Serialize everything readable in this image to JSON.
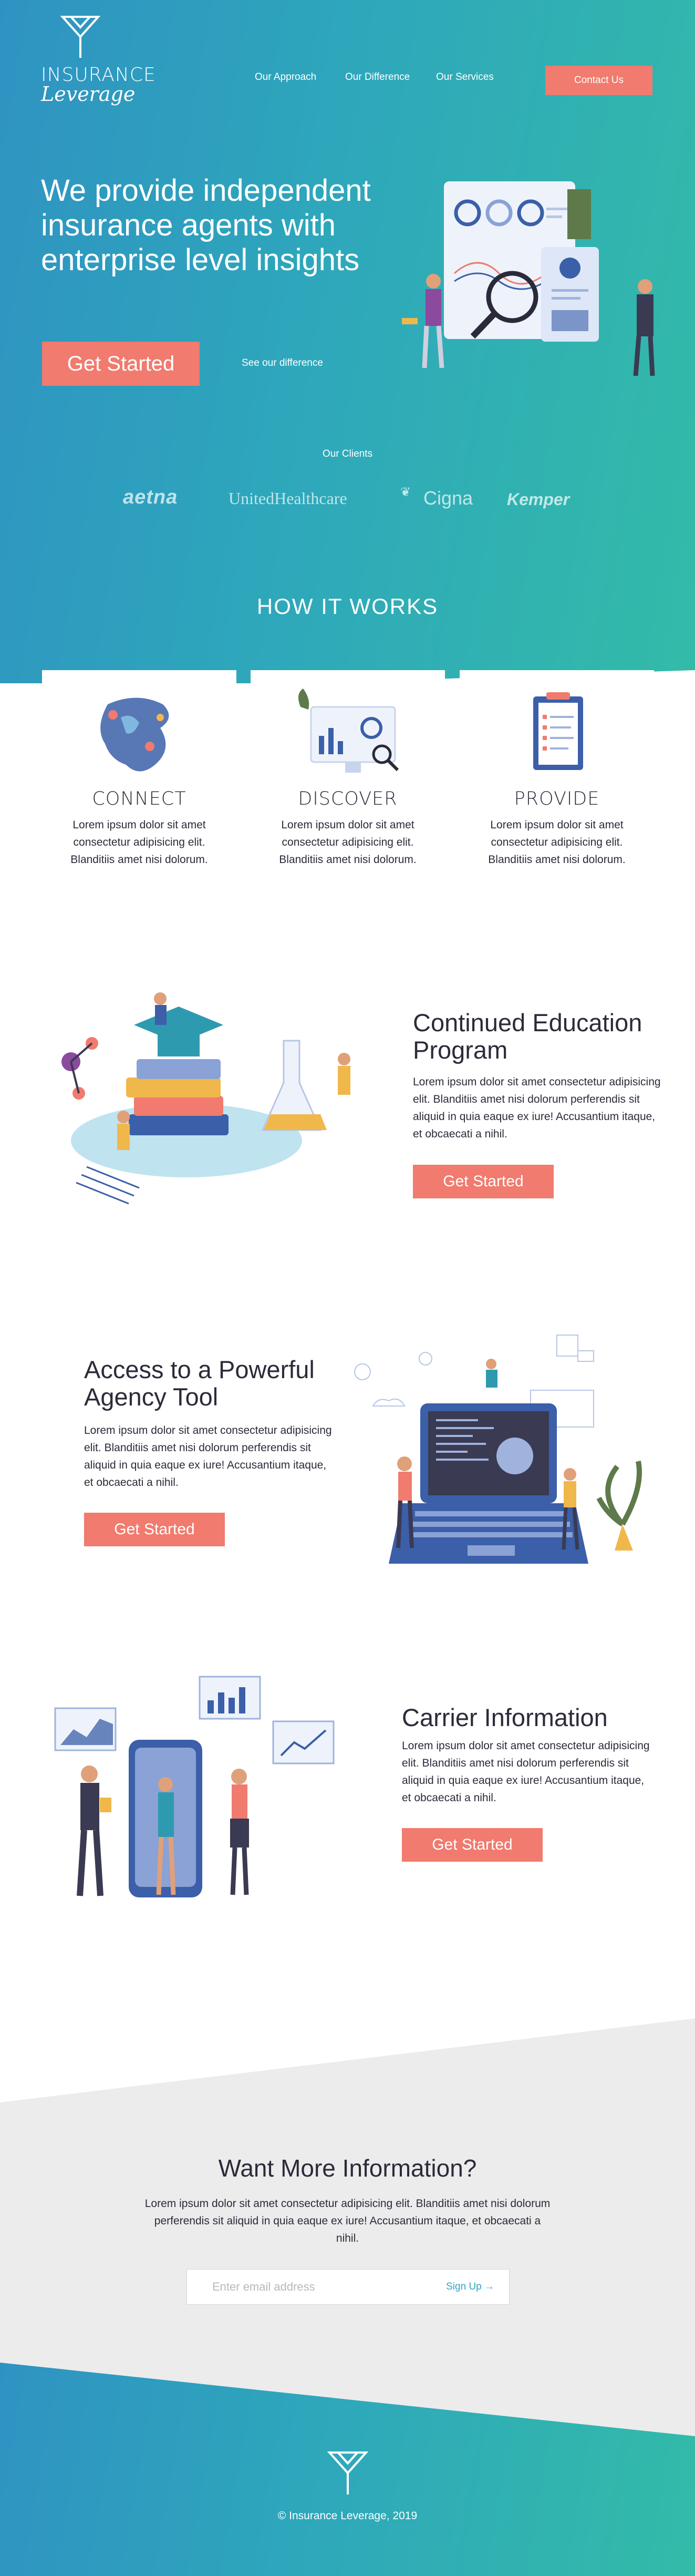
{
  "brand": {
    "name_line1": "INSURANCE",
    "name_line2": "Leverage"
  },
  "nav": {
    "items": [
      "Our Approach",
      "Our Difference",
      "Our Services"
    ],
    "contact": "Contact Us"
  },
  "hero": {
    "title": "We provide independent insurance agents with enterprise level insights",
    "cta": "Get Started",
    "secondary": "See our difference"
  },
  "clients": {
    "title": "Our Clients",
    "logos": [
      "aetna",
      "UnitedHealthcare",
      "Cigna",
      "Kemper"
    ]
  },
  "how_it_works": {
    "title": "HOW IT WORKS",
    "cards": [
      {
        "title": "CONNECT",
        "text": "Lorem ipsum dolor sit amet consectetur adipisicing elit. Blanditiis amet nisi dolorum."
      },
      {
        "title": "DISCOVER",
        "text": "Lorem ipsum dolor sit amet consectetur adipisicing elit. Blanditiis amet nisi dolorum."
      },
      {
        "title": "PROVIDE",
        "text": "Lorem ipsum dolor sit amet consectetur adipisicing elit. Blanditiis amet nisi dolorum."
      }
    ]
  },
  "features": [
    {
      "title": "Continued Education Program",
      "text": "Lorem ipsum dolor sit amet consectetur adipisicing elit. Blanditiis amet nisi dolorum perferendis sit aliquid in quia eaque ex iure! Accusantium itaque, et obcaecati a nihil.",
      "button": "Get Started"
    },
    {
      "title": "Access to a Powerful Agency Tool",
      "text": "Lorem ipsum dolor sit amet consectetur adipisicing elit. Blanditiis amet nisi dolorum perferendis sit aliquid in quia eaque ex iure! Accusantium itaque, et obcaecati a nihil.",
      "button": "Get Started"
    },
    {
      "title": "Carrier Information",
      "text": "Lorem ipsum dolor sit amet consectetur adipisicing elit. Blanditiis amet nisi dolorum perferendis sit aliquid in quia eaque ex iure! Accusantium itaque, et obcaecati a nihil.",
      "button": "Get Started"
    }
  ],
  "info": {
    "title": "Want More Information?",
    "text": "Lorem ipsum dolor sit amet consectetur adipisicing elit. Blanditiis amet nisi dolorum perferendis sit aliquid in quia eaque ex iure! Accusantium itaque, et obcaecati a nihil.",
    "email_placeholder": "Enter email address",
    "email_value": "",
    "signup": "Sign Up →"
  },
  "footer": {
    "copyright": "© Insurance Leverage, 2019"
  },
  "colors": {
    "accent": "#f07b6e",
    "gradient_start": "#2f93c2",
    "gradient_end": "#33bba8",
    "info_bg": "#ececec"
  }
}
